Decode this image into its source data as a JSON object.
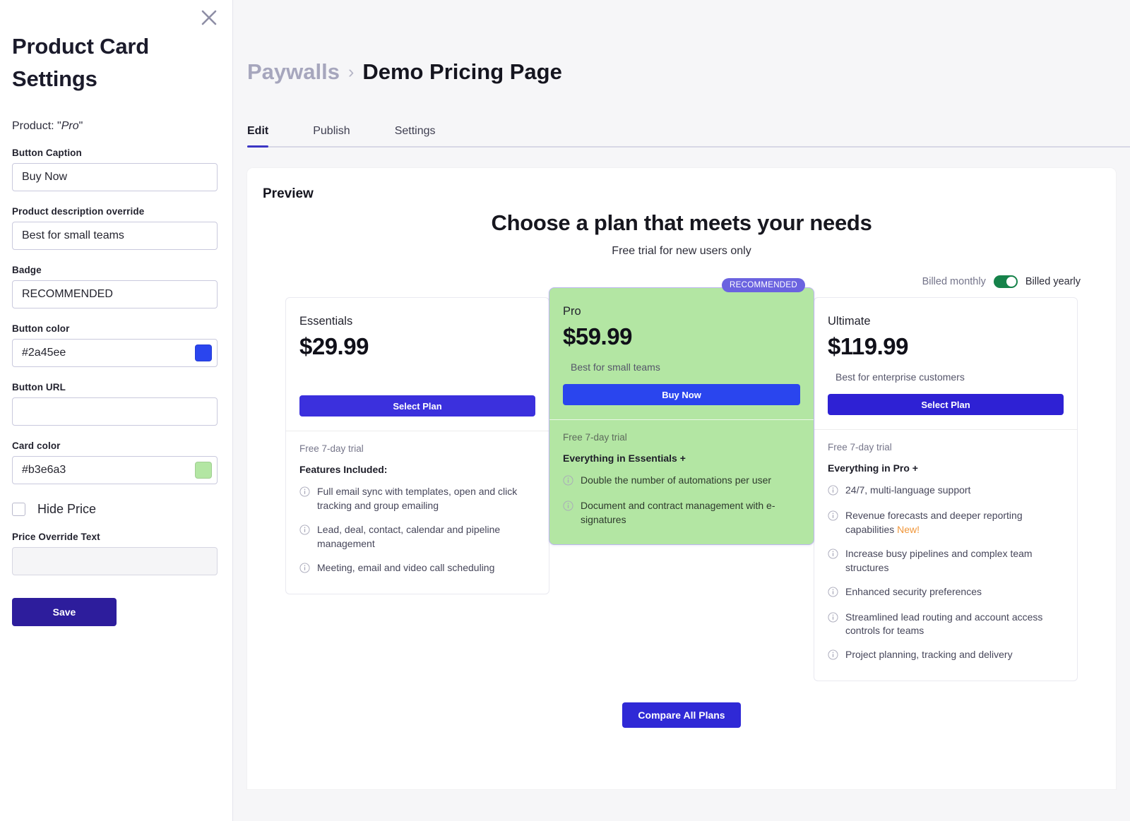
{
  "sidebar": {
    "title": "Product Card Settings",
    "close_icon": "close-icon",
    "product_prefix": "Product: \"",
    "product_name": "Pro",
    "product_suffix": "\"",
    "fields": {
      "button_caption_label": "Button Caption",
      "button_caption_value": "Buy Now",
      "description_label": "Product description override",
      "description_value": "Best for small teams",
      "badge_label": "Badge",
      "badge_value": "RECOMMENDED",
      "button_color_label": "Button color",
      "button_color_value": "#2a45ee",
      "button_url_label": "Button URL",
      "button_url_value": "",
      "card_color_label": "Card color",
      "card_color_value": "#b3e6a3",
      "hide_price_label": "Hide Price",
      "hide_price_checked": false,
      "price_override_label": "Price Override Text",
      "price_override_value": ""
    },
    "save_label": "Save"
  },
  "header": {
    "breadcrumb_parent": "Paywalls",
    "breadcrumb_separator": "›",
    "breadcrumb_current": "Demo Pricing Page",
    "tabs": [
      {
        "label": "Edit",
        "active": true
      },
      {
        "label": "Publish",
        "active": false
      },
      {
        "label": "Settings",
        "active": false
      }
    ]
  },
  "preview": {
    "label": "Preview",
    "title": "Choose a plan that meets your needs",
    "subtitle": "Free trial for new users only",
    "billing": {
      "left_label": "Billed monthly",
      "right_label": "Billed yearly",
      "yearly_selected": true,
      "toggle_color": "#16824a"
    },
    "badge_text": "RECOMMENDED",
    "badge_color": "#6b63e0",
    "plans": [
      {
        "name": "Essentials",
        "price": "$29.99",
        "description": "",
        "button_label": "Select Plan",
        "button_color": "#3b30dd",
        "card_color": "#ffffff",
        "trial": "Free 7-day trial",
        "features_heading": "Features Included:",
        "highlighted": false,
        "features": [
          {
            "text": "Full email sync with templates, open and click tracking and group emailing",
            "new": false
          },
          {
            "text": "Lead, deal, contact, calendar and pipeline management",
            "new": false
          },
          {
            "text": "Meeting, email and video call scheduling",
            "new": false
          }
        ]
      },
      {
        "name": "Pro",
        "price": "$59.99",
        "description": "Best for small teams",
        "button_label": "Buy Now",
        "button_color": "#2a45ee",
        "card_color": "#b3e6a3",
        "trial": "Free 7-day trial",
        "features_heading": "Everything in Essentials +",
        "highlighted": true,
        "features": [
          {
            "text": "Double the number of automations per user",
            "new": false
          },
          {
            "text": "Document and contract management with e-signatures",
            "new": false
          }
        ]
      },
      {
        "name": "Ultimate",
        "price": "$119.99",
        "description": "Best for enterprise customers",
        "button_label": "Select Plan",
        "button_color": "#2e21d4",
        "card_color": "#ffffff",
        "trial": "Free 7-day trial",
        "features_heading": "Everything in Pro +",
        "highlighted": false,
        "features": [
          {
            "text": "24/7, multi-language support",
            "new": false
          },
          {
            "text": "Revenue forecasts and deeper reporting capabilities ",
            "new": true,
            "new_label": "New!"
          },
          {
            "text": "Increase busy pipelines and complex team structures",
            "new": false
          },
          {
            "text": "Enhanced security preferences",
            "new": false
          },
          {
            "text": "Streamlined lead routing and account access controls for teams",
            "new": false
          },
          {
            "text": "Project planning, tracking and delivery",
            "new": false
          }
        ]
      }
    ],
    "compare_label": "Compare All Plans",
    "compare_color": "#2f29d6"
  }
}
